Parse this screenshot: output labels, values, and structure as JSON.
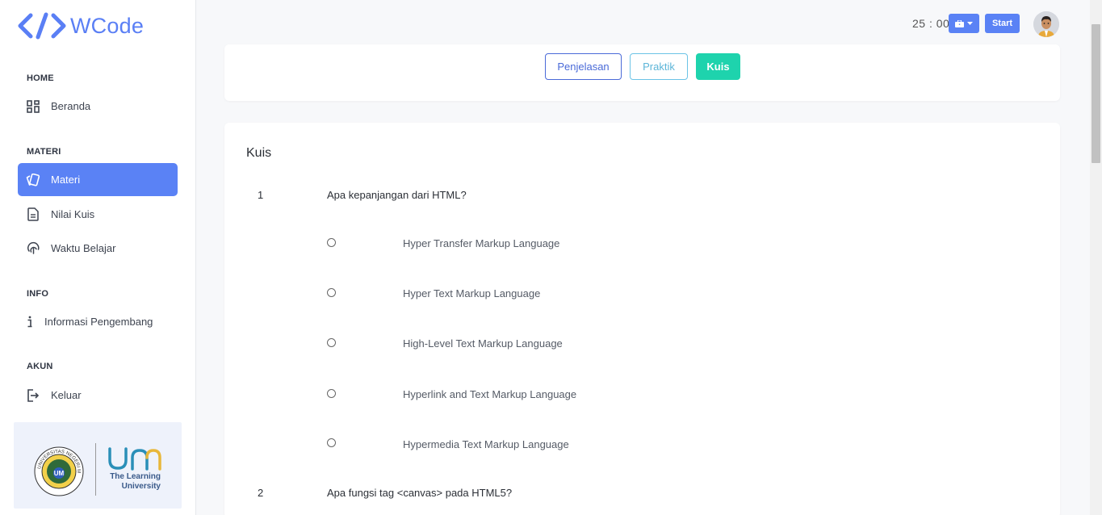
{
  "app": {
    "name": "WCode"
  },
  "sidebar": {
    "sections": [
      {
        "title": "HOME"
      },
      {
        "title": "MATERI"
      },
      {
        "title": "INFO"
      },
      {
        "title": "AKUN"
      }
    ],
    "items": [
      {
        "label": "Beranda",
        "icon": "dashboard-icon"
      },
      {
        "label": "Materi",
        "icon": "cards-icon",
        "active": true
      },
      {
        "label": "Nilai Kuis",
        "icon": "document-icon"
      },
      {
        "label": "Waktu Belajar",
        "icon": "fingerprint-icon"
      },
      {
        "label": "Informasi Pengembang",
        "icon": "info-icon"
      },
      {
        "label": "Keluar",
        "icon": "logout-icon"
      }
    ],
    "sponsor": {
      "seal_text": "UNIVERSITAS NEGERI MALANG",
      "logo_text": "um",
      "tagline_line1": "The Learning",
      "tagline_line2": "University"
    }
  },
  "topbar": {
    "timer": "25 : 00",
    "start_label": "Start"
  },
  "tabs": [
    {
      "label": "Penjelasan"
    },
    {
      "label": "Praktik"
    },
    {
      "label": "Kuis",
      "active": true
    }
  ],
  "quiz": {
    "title": "Kuis",
    "questions": [
      {
        "number": "1",
        "text": "Apa kepanjangan dari HTML?",
        "options": [
          "Hyper Transfer Markup Language",
          "Hyper Text Markup Language",
          "High-Level Text Markup Language",
          "Hyperlink and Text Markup Language",
          "Hypermedia Text Markup Language"
        ]
      },
      {
        "number": "2",
        "text": "Apa fungsi tag <canvas> pada HTML5?"
      }
    ]
  },
  "colors": {
    "primary": "#5a82f5",
    "accent_green": "#1ed3ad",
    "outline_blue": "#4a6ad8",
    "outline_cyan": "#6cc3e6"
  }
}
